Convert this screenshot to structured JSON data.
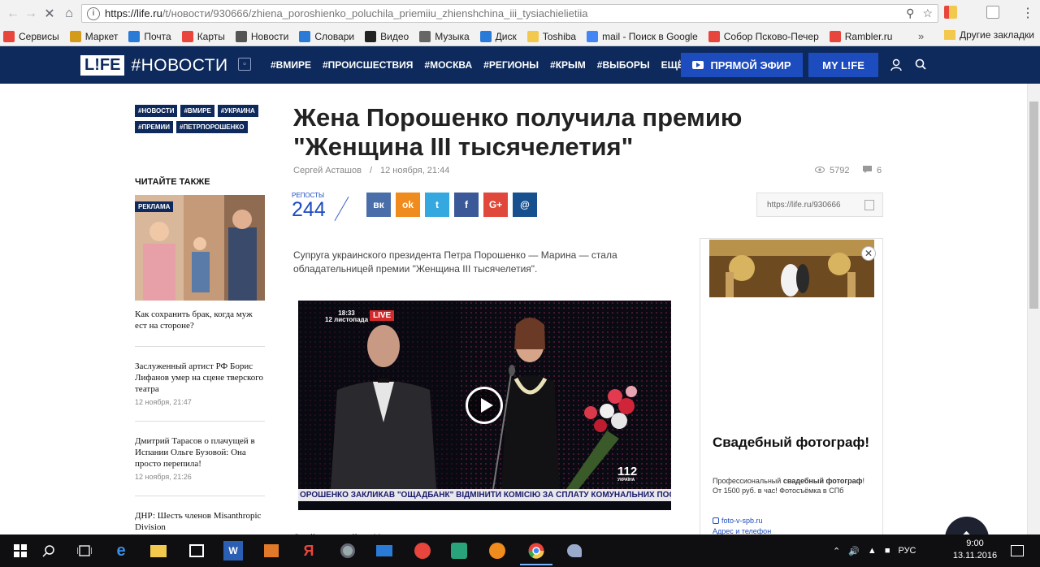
{
  "browser": {
    "url_host": "https://life.ru",
    "url_path": "/t/новости/930666/zhiena_poroshienko_poluchila_priemiiu_zhienshchina_iii_tysiachielietiia",
    "bookmarks": [
      {
        "label": "Сервисы",
        "icon": "apps-icon",
        "color": "#e8453c"
      },
      {
        "label": "Маркет",
        "icon": "market-icon",
        "color": "#d49a1a"
      },
      {
        "label": "Почта",
        "icon": "mail-icon",
        "color": "#2a7ad8"
      },
      {
        "label": "Карты",
        "icon": "map-pin-icon",
        "color": "#e8453c"
      },
      {
        "label": "Новости",
        "icon": "news-icon",
        "color": "#555555"
      },
      {
        "label": "Словари",
        "icon": "dictionary-icon",
        "color": "#2a7ad8"
      },
      {
        "label": "Видео",
        "icon": "video-icon",
        "color": "#222222"
      },
      {
        "label": "Музыка",
        "icon": "music-icon",
        "color": "#666666"
      },
      {
        "label": "Диск",
        "icon": "disk-icon",
        "color": "#2a7ad8"
      },
      {
        "label": "Toshiba",
        "icon": "folder-icon",
        "color": "#f2c94c"
      },
      {
        "label": "mail - Поиск в Google",
        "icon": "google-icon",
        "color": "#4285f4"
      },
      {
        "label": "Собор Псково-Печер",
        "icon": "yandex-icon",
        "color": "#e8453c"
      },
      {
        "label": "Rambler.ru",
        "icon": "yandex-icon",
        "color": "#e8453c"
      }
    ],
    "bookmarks_more": "»",
    "other_bookmarks": "Другие закладки"
  },
  "site": {
    "logo": "L!FE",
    "section": "#НОВОСТИ",
    "nav": [
      "#ВМИРЕ",
      "#ПРОИСШЕСТВИЯ",
      "#МОСКВА",
      "#РЕГИОНЫ",
      "#КРЫМ",
      "#ВЫБОРЫ",
      "ЕЩЁ"
    ],
    "live_label": "ПРЯМОЙ ЭФИР",
    "mylife_label": "MY L!FE"
  },
  "sidebar": {
    "tags": [
      "#НОВОСТИ",
      "#ВМИРЕ",
      "#УКРАИНА",
      "#ПРЕМИИ",
      "#ПЕТРПОРОШЕНКО"
    ],
    "read_also": "ЧИТАЙТЕ ТАКЖЕ",
    "promo_label": "РЕКЛАМА",
    "items": [
      {
        "title": "Как сохранить брак, когда муж ест на стороне?",
        "date": ""
      },
      {
        "title": "Заслуженный артист РФ Борис Лифанов умер на сцене тверского театра",
        "date": "12 ноября, 21:47"
      },
      {
        "title": "Дмитрий Тарасов о плачущей в Испании Ольге Бузовой: Она просто перепила!",
        "date": "12 ноября, 21:26"
      },
      {
        "title": "ДНР: Шесть членов Misanthropic Division",
        "date": ""
      }
    ]
  },
  "article": {
    "title": "Жена Порошенко получила премию \"Женщина III тысячелетия\"",
    "author": "Сергей Асташов",
    "separator": "/",
    "date": "12 ноября, 21:44",
    "views": "5792",
    "comments": "6",
    "reposts_label": "РЕПОСТЫ",
    "reposts_count": "244",
    "share": [
      {
        "name": "vk-share-button",
        "label": "вк",
        "color": "#4a6ea9"
      },
      {
        "name": "ok-share-button",
        "label": "ok",
        "color": "#f08b1d"
      },
      {
        "name": "twitter-share-button",
        "label": "t",
        "color": "#36a8e0"
      },
      {
        "name": "facebook-share-button",
        "label": "f",
        "color": "#3b5998"
      },
      {
        "name": "gplus-share-button",
        "label": "G+",
        "color": "#e0483b"
      },
      {
        "name": "mail-share-button",
        "label": "@",
        "color": "#16508e"
      }
    ],
    "short_url": "https://life.ru/930666",
    "lead": "Супруга украинского президента Петра Порошенко — Марина — стала обладательницей премии \"Женщина III тысячелетия\".",
    "video": {
      "time": "18:33",
      "date": "12 листопада",
      "live": "LIVE",
      "ticker": "ОРОШЕНКО ЗАКЛИКАВ \"ОЩАДБАНК\" ВІДМІНИТИ КОМІСІЮ ЗА СПЛАТУ КОМУНАЛЬНИХ ПОСЛУГ",
      "channel": "112",
      "channel_sub": "УКРАЇНА"
    },
    "next_paragraph": "Этой премией на Украине награждают женщин, которые успешно"
  },
  "ad": {
    "title": "Свадебный фотограф!",
    "text_plain": "Профессиональный ",
    "text_bold1": "свадебный фотограф",
    "text_rest": "! От 1500 руб. в час! Фотосъёмка в СПб",
    "link": "foto-v-spb.ru",
    "link2": "Адрес и телефон"
  },
  "taskbar": {
    "time": "9:00",
    "date": "13.11.2016",
    "lang": "РУС"
  }
}
